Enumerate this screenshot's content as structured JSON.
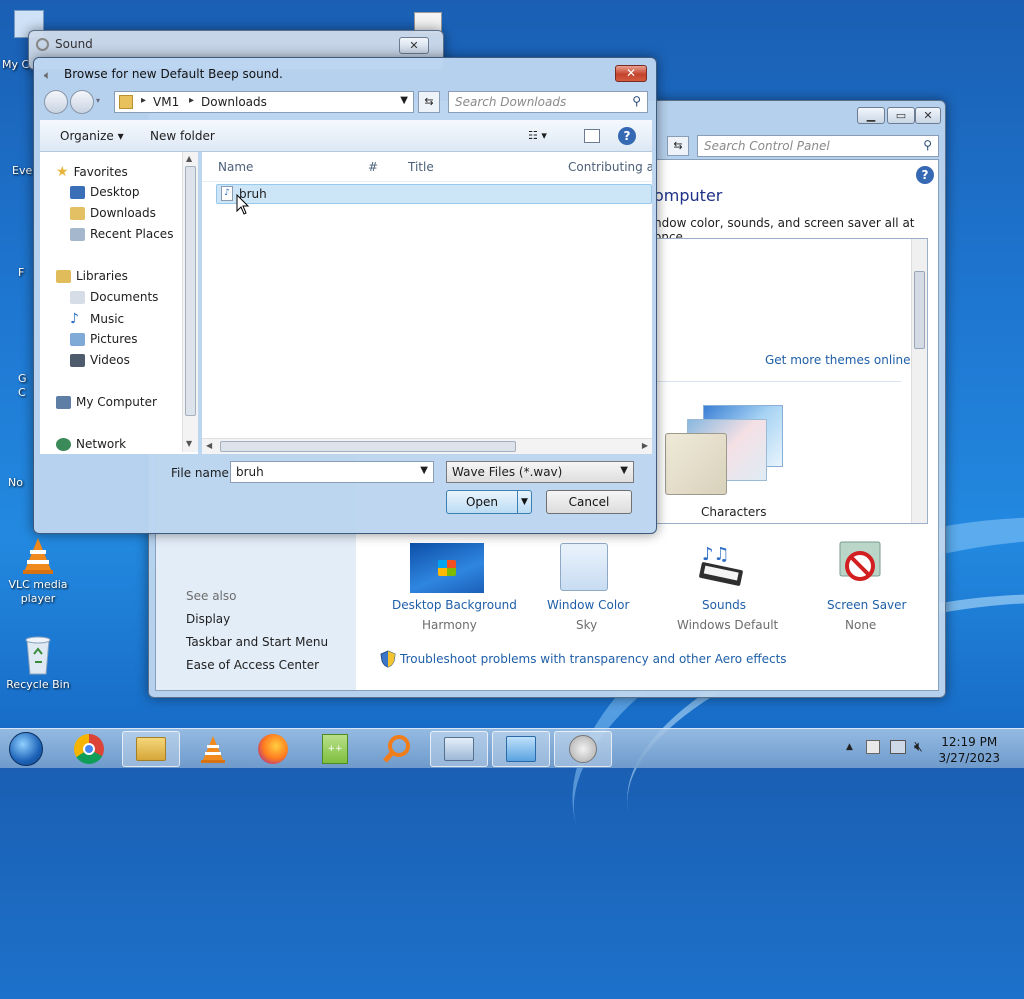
{
  "desktop": {
    "icons": [
      {
        "label": "VLC media player",
        "line1": "VLC media",
        "line2": "player",
        "icon": "vlc-cone-icon"
      },
      {
        "label": "Recycle Bin",
        "icon": "recycle-bin-icon"
      }
    ],
    "partial_labels": {
      "my": "My C",
      "eve": "Eve",
      "f": "F",
      "g": "G",
      "c": "C",
      "no": "No"
    }
  },
  "sound_window": {
    "title": "Sound",
    "close": "✕"
  },
  "control_panel": {
    "search_placeholder": "Search Control Panel",
    "heading_fragment": "omputer",
    "subtitle_fragment": "ndow color, sounds, and screen saver all at once.",
    "get_more_themes": "Get more themes online",
    "theme_name": "Characters",
    "see_also": "See also",
    "see_also_links": [
      "Display",
      "Taskbar and Start Menu",
      "Ease of Access Center"
    ],
    "settings": [
      {
        "label": "Desktop Background",
        "value": "Harmony",
        "icon": "desktop-background-icon"
      },
      {
        "label": "Window Color",
        "value": "Sky",
        "icon": "window-color-icon"
      },
      {
        "label": "Sounds",
        "value": "Windows Default",
        "icon": "sounds-icon"
      },
      {
        "label": "Screen Saver",
        "value": "None",
        "icon": "screen-saver-icon"
      }
    ],
    "troubleshoot": "Troubleshoot problems with transparency and other Aero effects",
    "buttons": {
      "minimize": "▁",
      "maximize": "▭",
      "close": "✕"
    }
  },
  "browse_dialog": {
    "title": "Browse for new Default Beep sound.",
    "close": "✕",
    "breadcrumb": [
      "VM1",
      "Downloads"
    ],
    "search_placeholder": "Search Downloads",
    "toolbar": {
      "organize": "Organize ▾",
      "new_folder": "New folder"
    },
    "nav": {
      "favorites": "Favorites",
      "favorite_items": [
        "Desktop",
        "Downloads",
        "Recent Places"
      ],
      "libraries": "Libraries",
      "library_items": [
        "Documents",
        "Music",
        "Pictures",
        "Videos"
      ],
      "computer": "My Computer",
      "network": "Network"
    },
    "columns": [
      "Name",
      "#",
      "Title",
      "Contributing art"
    ],
    "files": [
      {
        "name": "bruh",
        "icon": "audio-file-icon"
      }
    ],
    "file_name_label": "File name:",
    "file_name_value": "bruh",
    "file_type": "Wave Files (*.wav)",
    "open_label": "Open",
    "cancel_label": "Cancel"
  },
  "taskbar": {
    "items": [
      "start-orb-icon",
      "chrome-icon",
      "explorer-folder-icon",
      "vlc-icon",
      "firefox-icon",
      "notepad-plus-icon",
      "search-magnifier-icon",
      "remote-desktop-icon",
      "control-panel-icon",
      "speaker-icon"
    ],
    "time": "12:19 PM",
    "date": "3/27/2023"
  },
  "colors": {
    "accent": "#1e3287",
    "link": "#1f5fa8",
    "selected_row": "#cde6f7"
  }
}
